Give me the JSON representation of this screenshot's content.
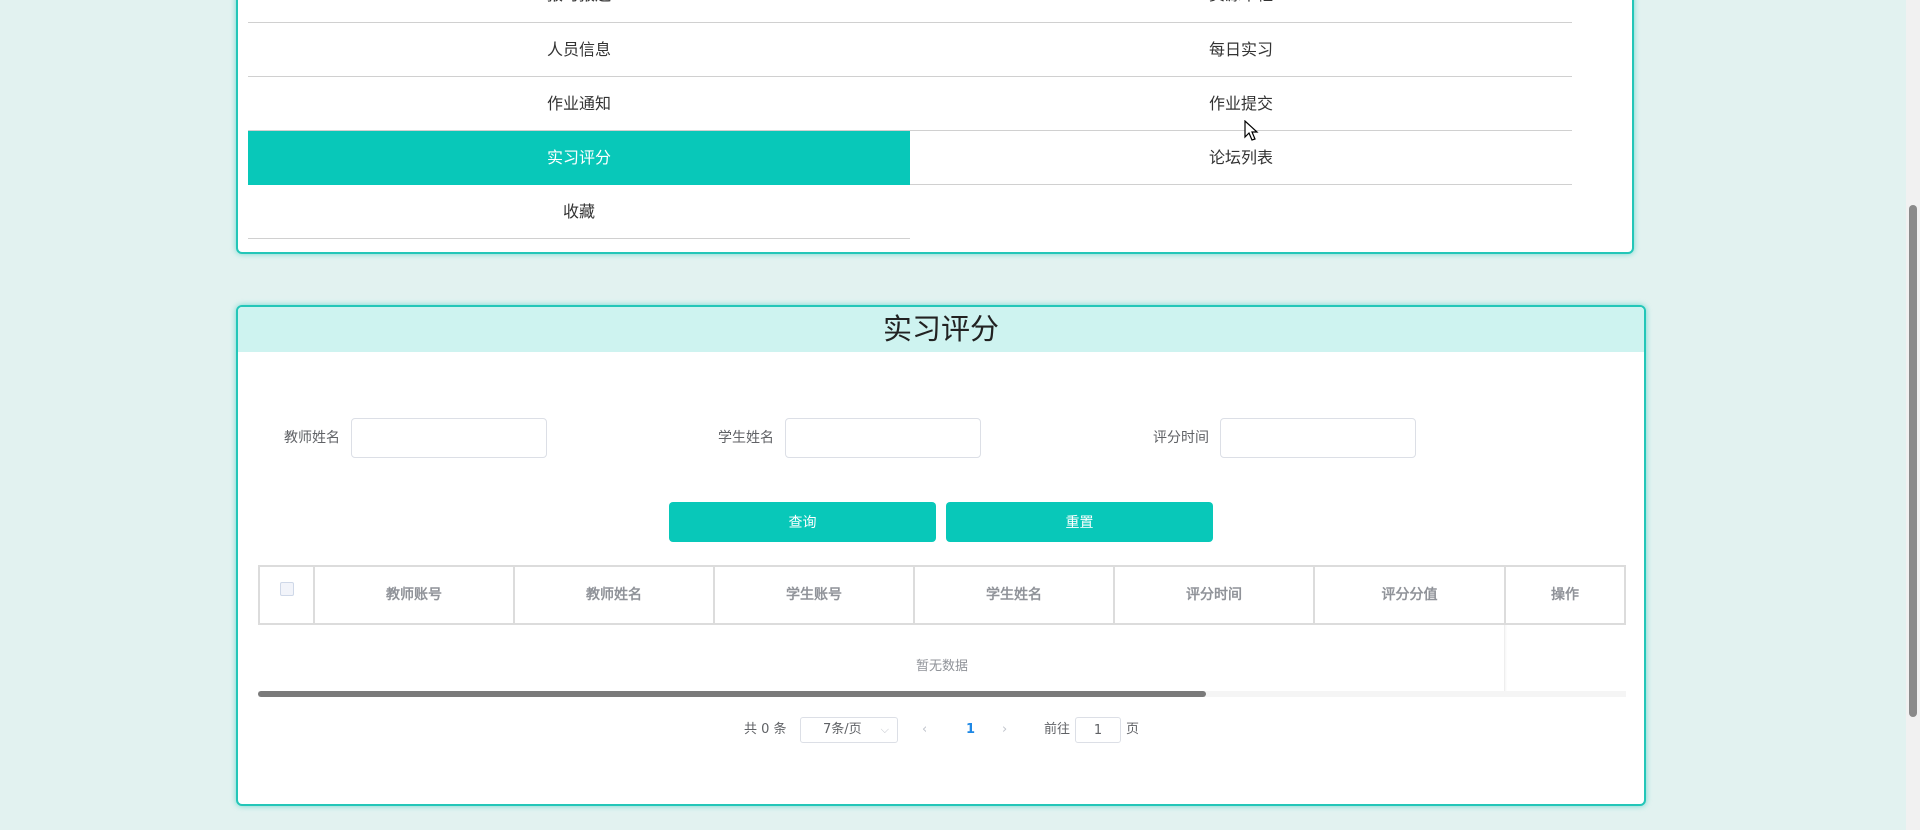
{
  "menu": {
    "items": [
      {
        "label": "报时报送"
      },
      {
        "label": "资源中枢"
      },
      {
        "label": "人员信息"
      },
      {
        "label": "每日实习"
      },
      {
        "label": "作业通知"
      },
      {
        "label": "作业提交"
      },
      {
        "label": "实习评分"
      },
      {
        "label": "论坛列表"
      },
      {
        "label": "收藏"
      }
    ]
  },
  "main": {
    "title": "实习评分",
    "filters": {
      "teacher_name": {
        "label": "教师姓名",
        "value": ""
      },
      "student_name": {
        "label": "学生姓名",
        "value": ""
      },
      "score_time": {
        "label": "评分时间",
        "value": ""
      }
    },
    "buttons": {
      "query": "查询",
      "reset": "重置"
    },
    "table": {
      "columns": [
        "教师账号",
        "教师姓名",
        "学生账号",
        "学生姓名",
        "评分时间",
        "评分分值",
        "操作"
      ],
      "rows": [],
      "empty_text": "暂无数据"
    },
    "pagination": {
      "total": "共 0 条",
      "page_size": "7条/页",
      "prev": "‹",
      "current_page": "1",
      "next": "›",
      "goto_label": "前往",
      "goto_value": "1",
      "page_unit": "页"
    }
  },
  "colors": {
    "accent": "#08c8b9",
    "header_bg": "#cef3f0",
    "page_bg": "#e2f2f0"
  }
}
